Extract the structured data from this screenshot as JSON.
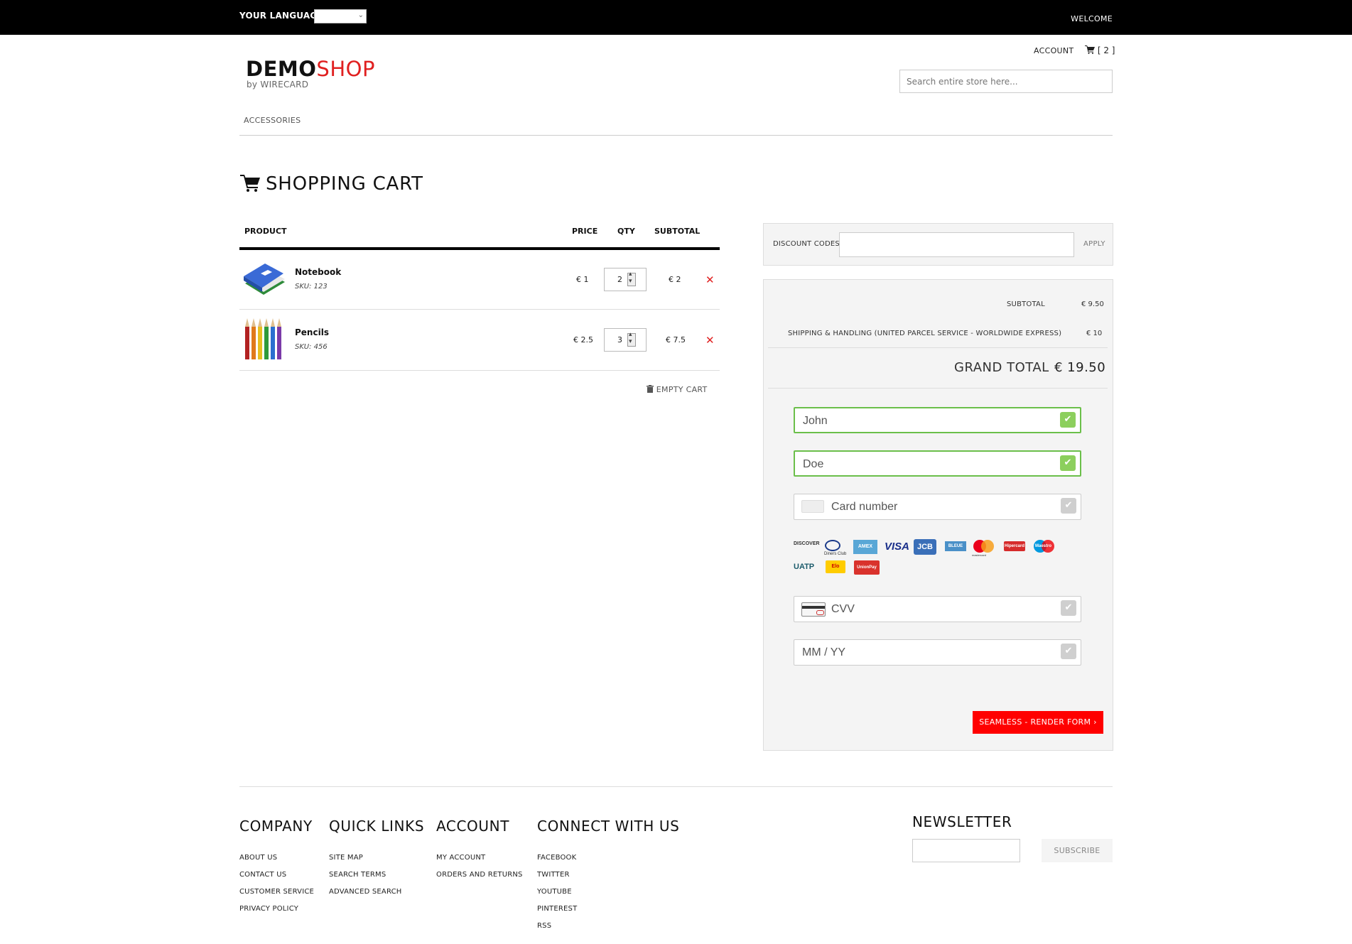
{
  "topbar": {
    "language_label": "YOUR LANGUAGE:",
    "welcome": "WELCOME"
  },
  "header": {
    "account": "ACCOUNT",
    "cart_count": "[ 2 ]",
    "logo_demo": "DEMO",
    "logo_shop": "SHOP",
    "logo_by": "by WIRECARD",
    "search_placeholder": "Search entire store here...",
    "nav": [
      "ACCESSORIES"
    ]
  },
  "page_title": "SHOPPING CART",
  "cart": {
    "columns": [
      "PRODUCT",
      "PRICE",
      "QTY",
      "SUBTOTAL"
    ],
    "items": [
      {
        "name": "Notebook",
        "sku": "SKU: 123",
        "price": "€ 1",
        "qty": "2",
        "subtotal": "€ 2"
      },
      {
        "name": "Pencils",
        "sku": "SKU: 456",
        "price": "€ 2.5",
        "qty": "3",
        "subtotal": "€ 7.5"
      }
    ],
    "empty_cart": "EMPTY CART"
  },
  "discount": {
    "label": "DISCOUNT CODES",
    "apply": "APPLY"
  },
  "totals": {
    "subtotal_label": "SUBTOTAL",
    "subtotal_value": "€ 9.50",
    "shipping_label": "SHIPPING & HANDLING (UNITED PARCEL SERVICE - WORLDWIDE EXPRESS)",
    "shipping_value": "€ 10",
    "grand_label": "GRAND TOTAL",
    "grand_value": "€ 19.50"
  },
  "payment_form": {
    "first_name": "John",
    "last_name": "Doe",
    "card_number_placeholder": "Card number",
    "cvv_placeholder": "CVV",
    "expiry_placeholder": "MM / YY",
    "card_brands": [
      "DISCOVER",
      "Diners Club",
      "AMEX",
      "VISA",
      "JCB",
      "BLEUE",
      "mastercard",
      "Hipercard",
      "Maestro",
      "UATP",
      "Elo",
      "UnionPay"
    ],
    "submit": "SEAMLESS - RENDER FORM ›",
    "valid_color": "#6bbf4a",
    "submit_color": "#ff0000"
  },
  "footer": {
    "columns": [
      {
        "title": "COMPANY",
        "links": [
          "ABOUT US",
          "CONTACT US",
          "CUSTOMER SERVICE",
          "PRIVACY POLICY"
        ]
      },
      {
        "title": "QUICK LINKS",
        "links": [
          "SITE MAP",
          "SEARCH TERMS",
          "ADVANCED SEARCH"
        ]
      },
      {
        "title": "ACCOUNT",
        "links": [
          "MY ACCOUNT",
          "ORDERS AND RETURNS"
        ]
      },
      {
        "title": "CONNECT WITH US",
        "links": [
          "FACEBOOK",
          "TWITTER",
          "YOUTUBE",
          "PINTEREST",
          "RSS"
        ]
      }
    ],
    "newsletter_title": "NEWSLETTER",
    "subscribe": "SUBSCRIBE"
  }
}
